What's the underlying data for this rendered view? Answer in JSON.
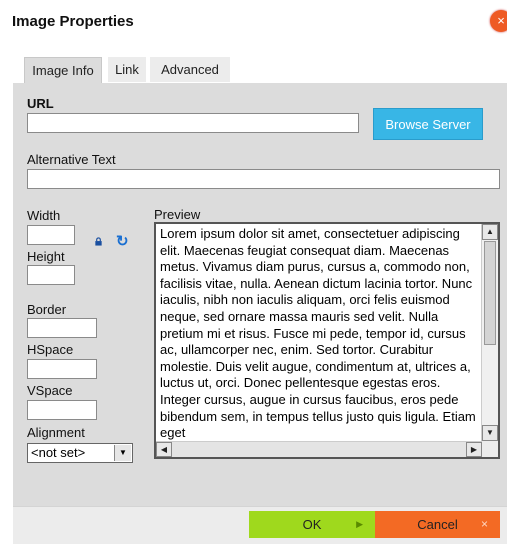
{
  "dialog": {
    "title": "Image Properties",
    "close_glyph": "×"
  },
  "tabs": [
    {
      "label": "Image Info",
      "selected": true
    },
    {
      "label": "Link",
      "selected": false
    },
    {
      "label": "Advanced",
      "selected": false
    }
  ],
  "info": {
    "url_label": "URL",
    "url_value": "",
    "browse_label": "Browse Server",
    "alt_label": "Alternative Text",
    "alt_value": "",
    "width_label": "Width",
    "width_value": "",
    "height_label": "Height",
    "height_value": "",
    "border_label": "Border",
    "border_value": "",
    "hspace_label": "HSpace",
    "hspace_value": "",
    "vspace_label": "VSpace",
    "vspace_value": "",
    "alignment_label": "Alignment",
    "alignment_value": "<not set>",
    "preview_label": "Preview",
    "preview_text": "Lorem ipsum dolor sit amet, consectetuer adipiscing elit. Maecenas feugiat consequat diam. Maecenas metus. Vivamus diam purus, cursus a, commodo non, facilisis vitae, nulla. Aenean dictum lacinia tortor. Nunc iaculis, nibh non iaculis aliquam, orci felis euismod neque, sed ornare massa mauris sed velit. Nulla pretium mi et risus. Fusce mi pede, tempor id, cursus ac, ullamcorper nec, enim. Sed tortor. Curabitur molestie. Duis velit augue, condimentum at, ultrices a, luctus ut, orci. Donec pellentesque egestas eros. Integer cursus, augue in cursus faucibus, eros pede bibendum sem, in tempus tellus justo quis ligula. Etiam eget"
  },
  "footer": {
    "ok_label": "OK",
    "cancel_label": "Cancel",
    "cancel_glyph": "×"
  },
  "icons": {
    "close": "close-icon",
    "lock": "lock-icon",
    "reset": "reset-size-icon",
    "dropdown": "chevron-down-icon"
  },
  "colors": {
    "accent_blue": "#38b6e6",
    "ok_green": "#9fd91d",
    "cancel_orange": "#f36a24",
    "panel_bg": "#dcdcdc",
    "close_orange": "#ee5a24"
  }
}
